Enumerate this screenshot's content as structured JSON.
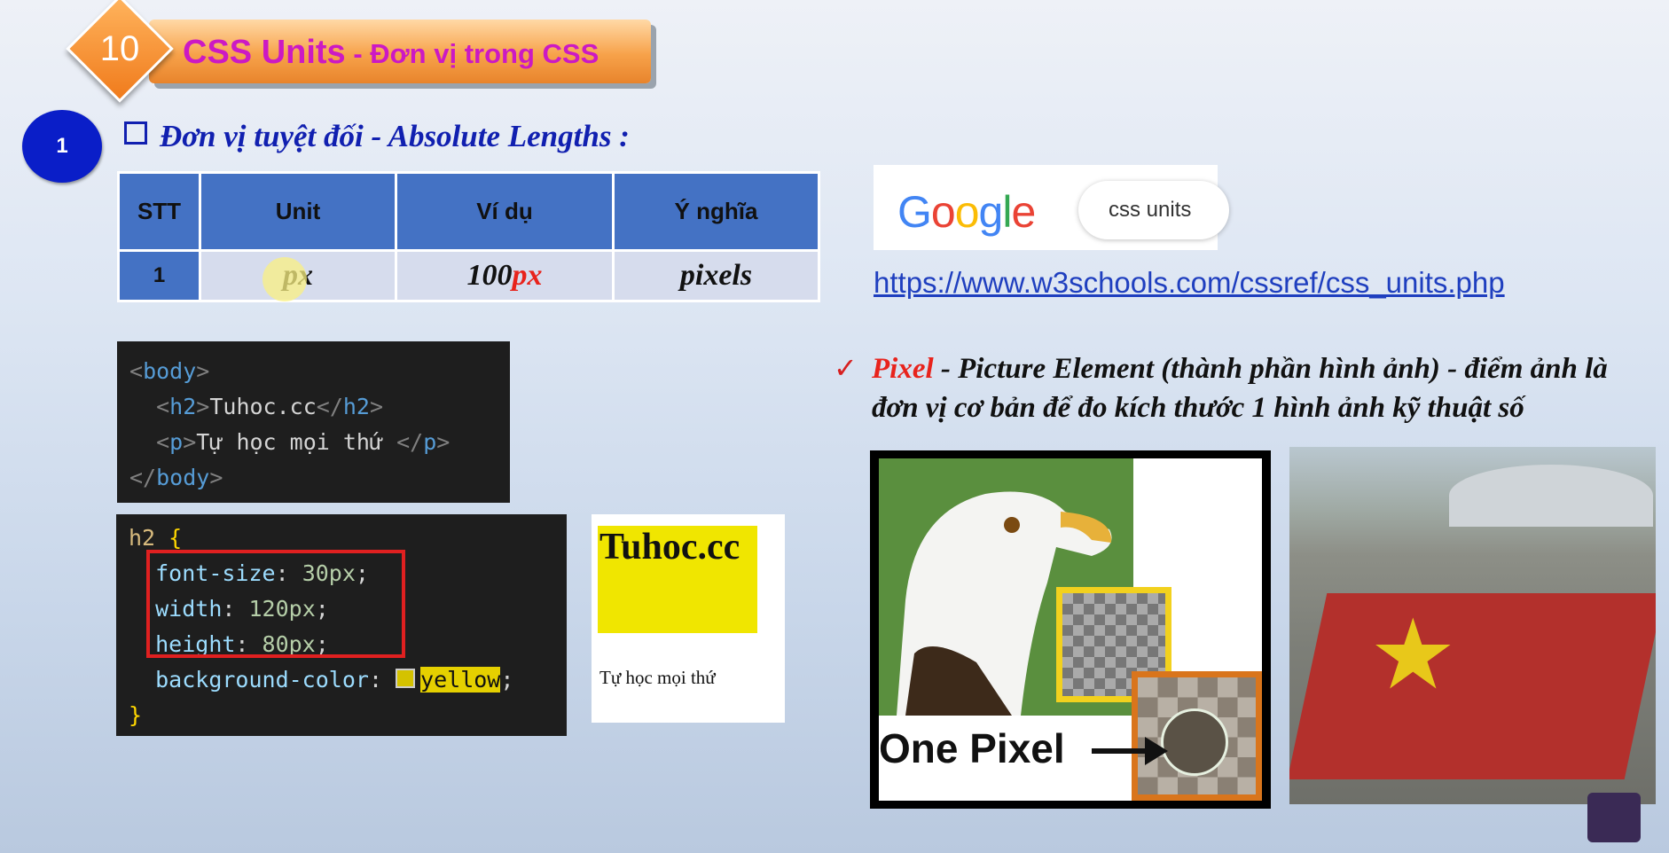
{
  "title": {
    "number": "10",
    "main": "CSS Units",
    "sub": " - Đơn vị trong CSS"
  },
  "section": {
    "number": "1",
    "heading": "Đơn vị tuyệt đối - Absolute Lengths :"
  },
  "table": {
    "headers": [
      "STT",
      "Unit",
      "Ví dụ",
      "Ý nghĩa"
    ],
    "row": {
      "stt": "1",
      "unit": "px",
      "example_num": "100",
      "example_unit": "px",
      "meaning": "pixels"
    }
  },
  "google": {
    "logo": [
      "G",
      "o",
      "o",
      "g",
      "l",
      "e"
    ],
    "query": "css units"
  },
  "link": "https://www.w3schools.com/cssref/css_units.php",
  "html_code": {
    "line1_tag": "body",
    "line2_tag": "h2",
    "line2_text": "Tuhoc.cc",
    "line3_tag": "p",
    "line3_text": "Tự học mọi thứ ",
    "line4_tag": "body"
  },
  "css_code": {
    "selector": "h2",
    "props": [
      {
        "name": "font-size",
        "value": "30px"
      },
      {
        "name": "width",
        "value": "120px"
      },
      {
        "name": "height",
        "value": "80px"
      },
      {
        "name": "background-color",
        "value": "yellow"
      }
    ]
  },
  "preview": {
    "h2": "Tuhoc.cc",
    "p": "Tự học mọi thứ"
  },
  "pixel_desc": {
    "term": "Pixel",
    "rest": " - Picture Element (thành phần hình ảnh) - điểm ảnh là đơn vị cơ bản để đo kích thước 1 hình ảnh kỹ thuật số"
  },
  "eagle_caption": "One Pixel",
  "colors": {
    "banner_text": "#cc19c4",
    "heading": "#1120b0",
    "table_header": "#4472c4",
    "accent_red": "#e8231c"
  }
}
